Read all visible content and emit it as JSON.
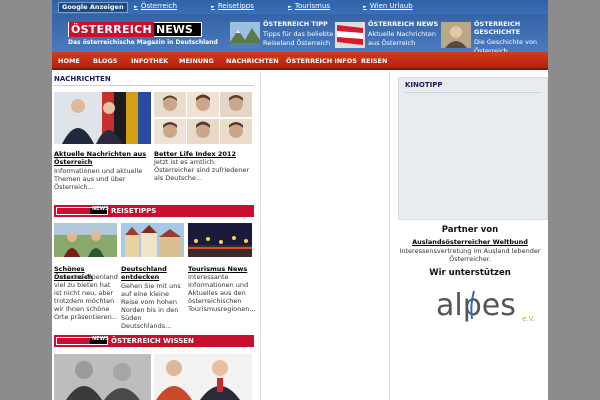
{
  "adbar": {
    "label": "Google Anzeigen",
    "links": [
      "Österreich",
      "Reisetipps",
      "Tourismus",
      "Wien Urlaub"
    ]
  },
  "logo": {
    "name_main": "ÖSTERREICH",
    "name_news": "NEWS",
    "tagline": "Das österreichische Magazin in Deutschland"
  },
  "promos": [
    {
      "title": "ÖSTERREICH TIPP",
      "text": "Tipps für das beliebte Reiseland Österreich"
    },
    {
      "title": "ÖSTERREICH NEWS",
      "text": "Aktuelle Nachrichten aus Österreich"
    },
    {
      "title": "ÖSTERREICH GESCHICHTE",
      "text": "Die Geschichte von Österreich"
    }
  ],
  "nav": [
    "HOME",
    "BLOGS",
    "INFOTHEK",
    "MEINUNG",
    "NACHRICHTEN",
    "ÖSTERREICH INFOS",
    "REISEN"
  ],
  "nachrichten": {
    "heading": "NACHRICHTEN",
    "cards": [
      {
        "title": "Aktuelle Nachrichten aus Österreich",
        "text": "Informationen und aktuelle Themen aus und über Österreich..."
      },
      {
        "title": "Better Life Index 2012",
        "text": "Jetzt ist es amtlich: Österreicher sind zufriedener als Deutsche..."
      }
    ]
  },
  "reisetipps": {
    "mini_logo_news": "NEWS",
    "heading": "REISETIPPS",
    "cards": [
      {
        "title": "Schönes Österreich",
        "text": "Dass das Alpenland viel zu bieten hat ist nicht neu, aber trotzdem möchten wir Ihnen schöne Orte präsentieren..."
      },
      {
        "title": "Deutschland entdecken",
        "text": "Gehen Sie mit uns auf eine kleine Reise vom hohen Norden bis in den Süden Deutschlands..."
      },
      {
        "title": "Tourismus News",
        "text": "Interessante Informationen und Aktuelles aus den österreichischen Tourismusregionen..."
      }
    ]
  },
  "wissen": {
    "mini_logo_news": "NEWS",
    "heading": "ÖSTERREICH WISSEN"
  },
  "kinotipp": {
    "heading": "KINOTIPP"
  },
  "partner": {
    "heading": "Partner von",
    "link": "Auslandsösterreicher Weltbund",
    "text": "Interessensvertretung im Ausland lebender Österreicher.",
    "support_heading": "Wir unterstützen",
    "alpes_brand": "alpes",
    "alpes_suffix": "e.V."
  },
  "colors": {
    "nav_red": "#c8102e",
    "header_blue": "#2d5a9c",
    "heading_navy": "#1a1a5a"
  }
}
